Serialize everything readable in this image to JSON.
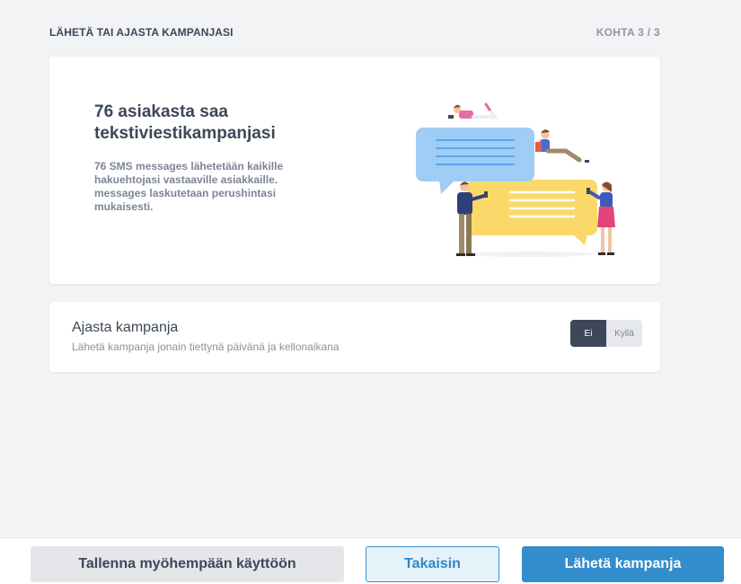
{
  "header": {
    "title": "LÄHETÄ TAI AJASTA KAMPANJASI",
    "step": "KOHTA 3 / 3"
  },
  "info_card": {
    "title": "76 asiakasta saa tekstiviestikampanjasi",
    "description": "76 SMS messages lähetetään kaikille hakuehtojasi vastaaville asiakkaille. messages laskutetaan perushintasi mukaisesti.",
    "illustration": "people-chat-bubbles-illustration"
  },
  "schedule_card": {
    "title": "Ajasta kampanja",
    "description": "Lähetä kampanja jonain tiettynä päivänä ja kellonaikana",
    "toggle": {
      "off_label": "Ei",
      "on_label": "Kyllä",
      "selected": "Ei"
    }
  },
  "footer": {
    "save_label": "Tallenna myöhempään käyttöön",
    "back_label": "Takaisin",
    "send_label": "Lähetä kampanja"
  },
  "colors": {
    "background": "#f2f3f5",
    "card": "#ffffff",
    "text_dark": "#3d4758",
    "primary": "#338ccb",
    "bubble_blue": "#9fcdf5",
    "bubble_yellow": "#fbd86a"
  }
}
